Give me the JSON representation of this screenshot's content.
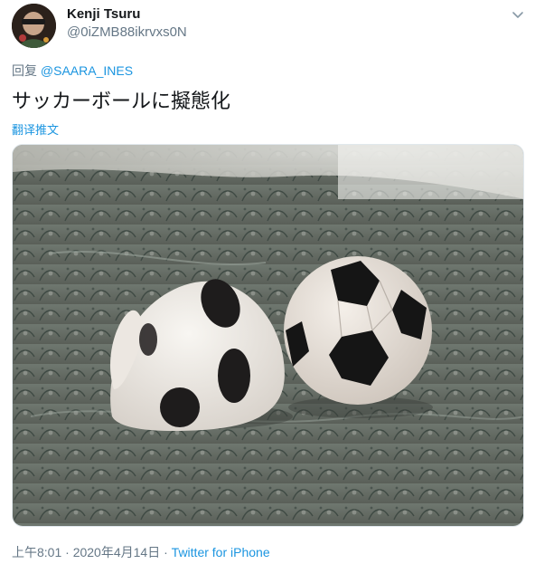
{
  "author": {
    "display_name": "Kenji Tsuru",
    "handle": "@0iZMB88ikrvxs0N"
  },
  "reply": {
    "prefix": "回复",
    "mention": "@SAARA_INES"
  },
  "tweet": {
    "text": "サッカーボールに擬態化",
    "translate_label": "翻译推文"
  },
  "meta": {
    "time": "上午8:01",
    "separator": " · ",
    "date": "2020年4月14日",
    "separator2": " · ",
    "source": "Twitter for iPhone"
  },
  "icons": {
    "caret": "chevron-down-icon"
  },
  "colors": {
    "link": "#1b95e0",
    "secondary_text": "#657786",
    "primary_text": "#14171a"
  }
}
